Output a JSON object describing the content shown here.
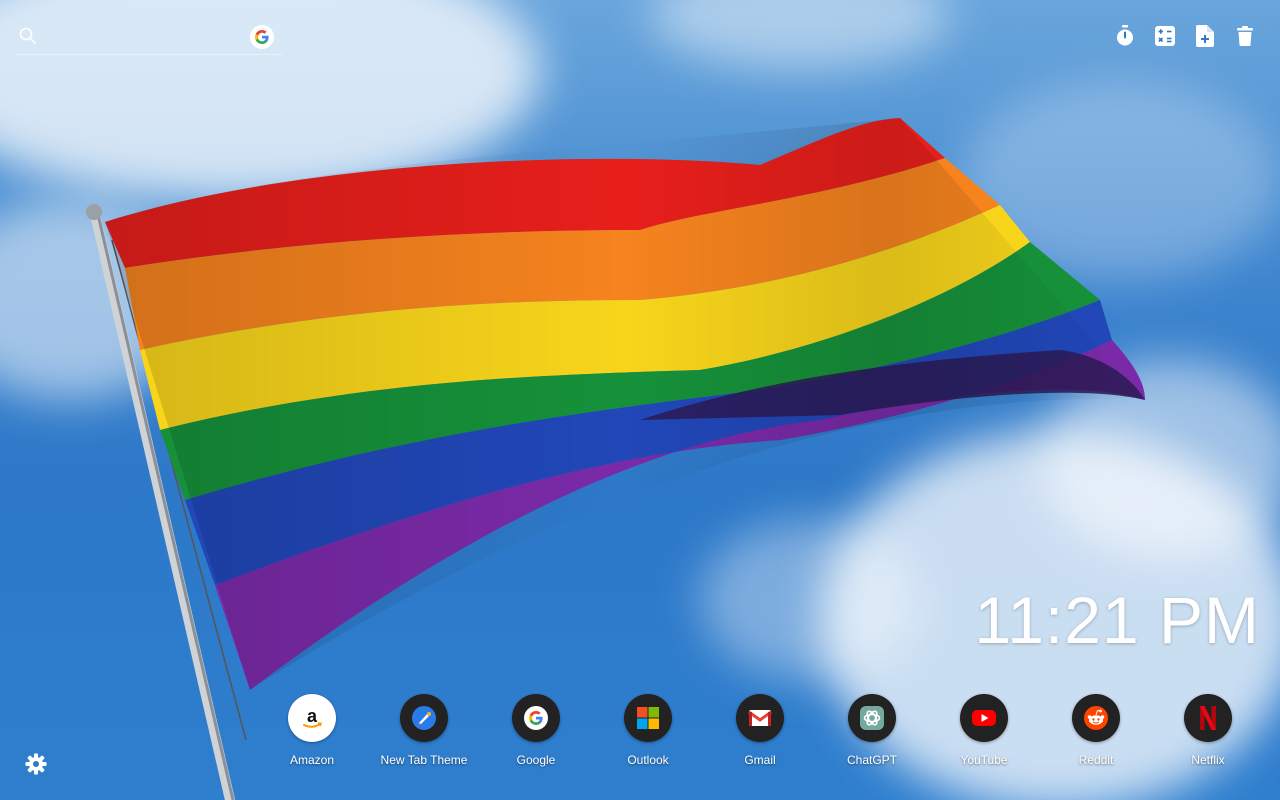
{
  "search": {
    "placeholder": "",
    "value": "",
    "icon": "search-icon",
    "engine_icon": "google-icon"
  },
  "toolbar": [
    {
      "icon": "stopwatch-icon"
    },
    {
      "icon": "calculator-icon"
    },
    {
      "icon": "new-note-icon"
    },
    {
      "icon": "trash-icon"
    }
  ],
  "clock": {
    "time": "11:21 PM"
  },
  "shortcuts": [
    {
      "label": "Amazon",
      "icon": "amazon-icon"
    },
    {
      "label": "New Tab Theme",
      "icon": "new-tab-theme-icon"
    },
    {
      "label": "Google",
      "icon": "google-icon"
    },
    {
      "label": "Outlook",
      "icon": "microsoft-icon"
    },
    {
      "label": "Gmail",
      "icon": "gmail-icon"
    },
    {
      "label": "ChatGPT",
      "icon": "chatgpt-icon"
    },
    {
      "label": "YouTube",
      "icon": "youtube-icon"
    },
    {
      "label": "Reddit",
      "icon": "reddit-icon"
    },
    {
      "label": "Netflix",
      "icon": "netflix-icon"
    }
  ],
  "settings": {
    "icon": "gear-icon"
  },
  "colors": {
    "sky": "#2d78c8",
    "tile": "#222222",
    "text": "#ffffff",
    "flag": [
      "#e40303",
      "#ff8c00",
      "#ffed00",
      "#008026",
      "#24408e",
      "#732982"
    ]
  }
}
